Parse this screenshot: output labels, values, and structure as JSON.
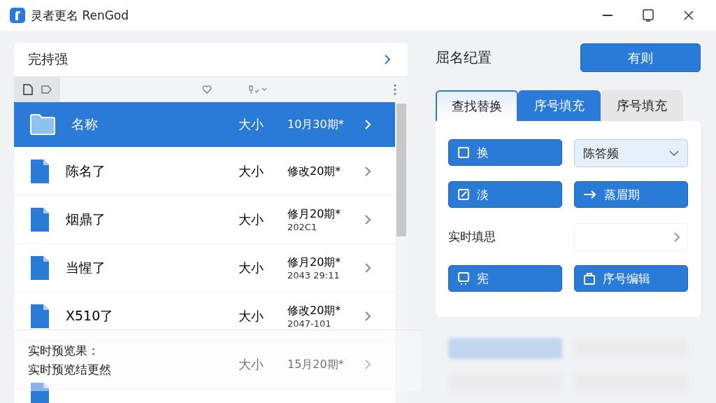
{
  "window": {
    "title": "灵者更名 RenGod"
  },
  "browser": {
    "header": "完持强",
    "rows": [
      {
        "kind": "folder",
        "name": "名称",
        "size": "大小",
        "date": "10月30期*",
        "selected": true
      },
      {
        "kind": "file",
        "name": "陈名了",
        "size": "大小",
        "date": "修改20期*",
        "selected": false
      },
      {
        "kind": "file",
        "name": "烟鼎了",
        "size": "大小",
        "date": "修月20期*",
        "sub": "202C1",
        "selected": false
      },
      {
        "kind": "file",
        "name": "当惺了",
        "size": "大小",
        "date": "修月20期*",
        "sub": "2043 29:11",
        "selected": false
      },
      {
        "kind": "file",
        "name": "X510了",
        "size": "大小",
        "date": "修改20期*",
        "sub": "2047-101",
        "selected": false
      },
      {
        "kind": "file",
        "size": "大小",
        "date": "15月20期*",
        "selected": false
      }
    ],
    "preview": {
      "title": "实时预览果：",
      "text": "实时预览结更然"
    }
  },
  "settings": {
    "title": "屈名纪置",
    "apply": "有则",
    "tabs": [
      {
        "label": "查找替换",
        "selected": true,
        "kind": "plain"
      },
      {
        "label": "序号填充",
        "selected": false,
        "kind": "primary"
      },
      {
        "label": "序号填充",
        "selected": false,
        "kind": "muted"
      }
    ],
    "controls": [
      {
        "kind": "button",
        "label": "换"
      },
      {
        "kind": "dropdown",
        "label": "陈答频"
      },
      {
        "kind": "button",
        "label": "淡"
      },
      {
        "kind": "button",
        "label": "蒸眉期"
      },
      {
        "kind": "label",
        "label": "实时填思"
      },
      {
        "kind": "field"
      },
      {
        "kind": "button",
        "label": "宪"
      },
      {
        "kind": "button",
        "label": "序号编辑"
      }
    ]
  }
}
